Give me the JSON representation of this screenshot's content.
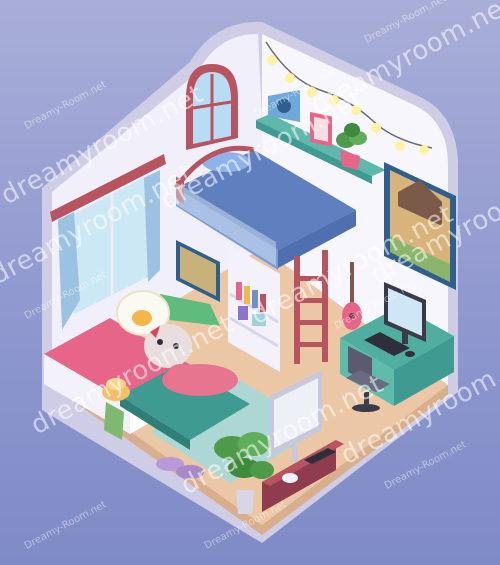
{
  "watermark": {
    "big": "dreamyroom.net",
    "small": "Dreamy-Room.net"
  },
  "colors": {
    "background": "#8f98cf",
    "wall": "#f4f3fb",
    "wall_shade": "#d9d8ee",
    "floor": "#e9c6a8",
    "rug": "#9fd2d6",
    "bed_blue": "#6f8fcf",
    "pink": "#e8658a",
    "teal": "#3f9b92",
    "wood": "#b8545f"
  },
  "icons": [
    "arched-window-icon",
    "string-lights-icon",
    "radio-icon",
    "picture-frame-icon",
    "potted-plant-icon",
    "wall-poster-icon",
    "curtain-window-icon",
    "loft-bed-icon",
    "ladder-icon",
    "guitar-icon",
    "bookshelf-icon",
    "computer-monitor-icon",
    "keyboard-icon",
    "office-chair-icon",
    "desk-icon",
    "daybed-icon",
    "mouse-character-icon",
    "popcorn-bucket-icon",
    "slippers-icon",
    "tv-icon",
    "game-console-icon",
    "game-controller-icon",
    "monstera-plant-icon"
  ]
}
